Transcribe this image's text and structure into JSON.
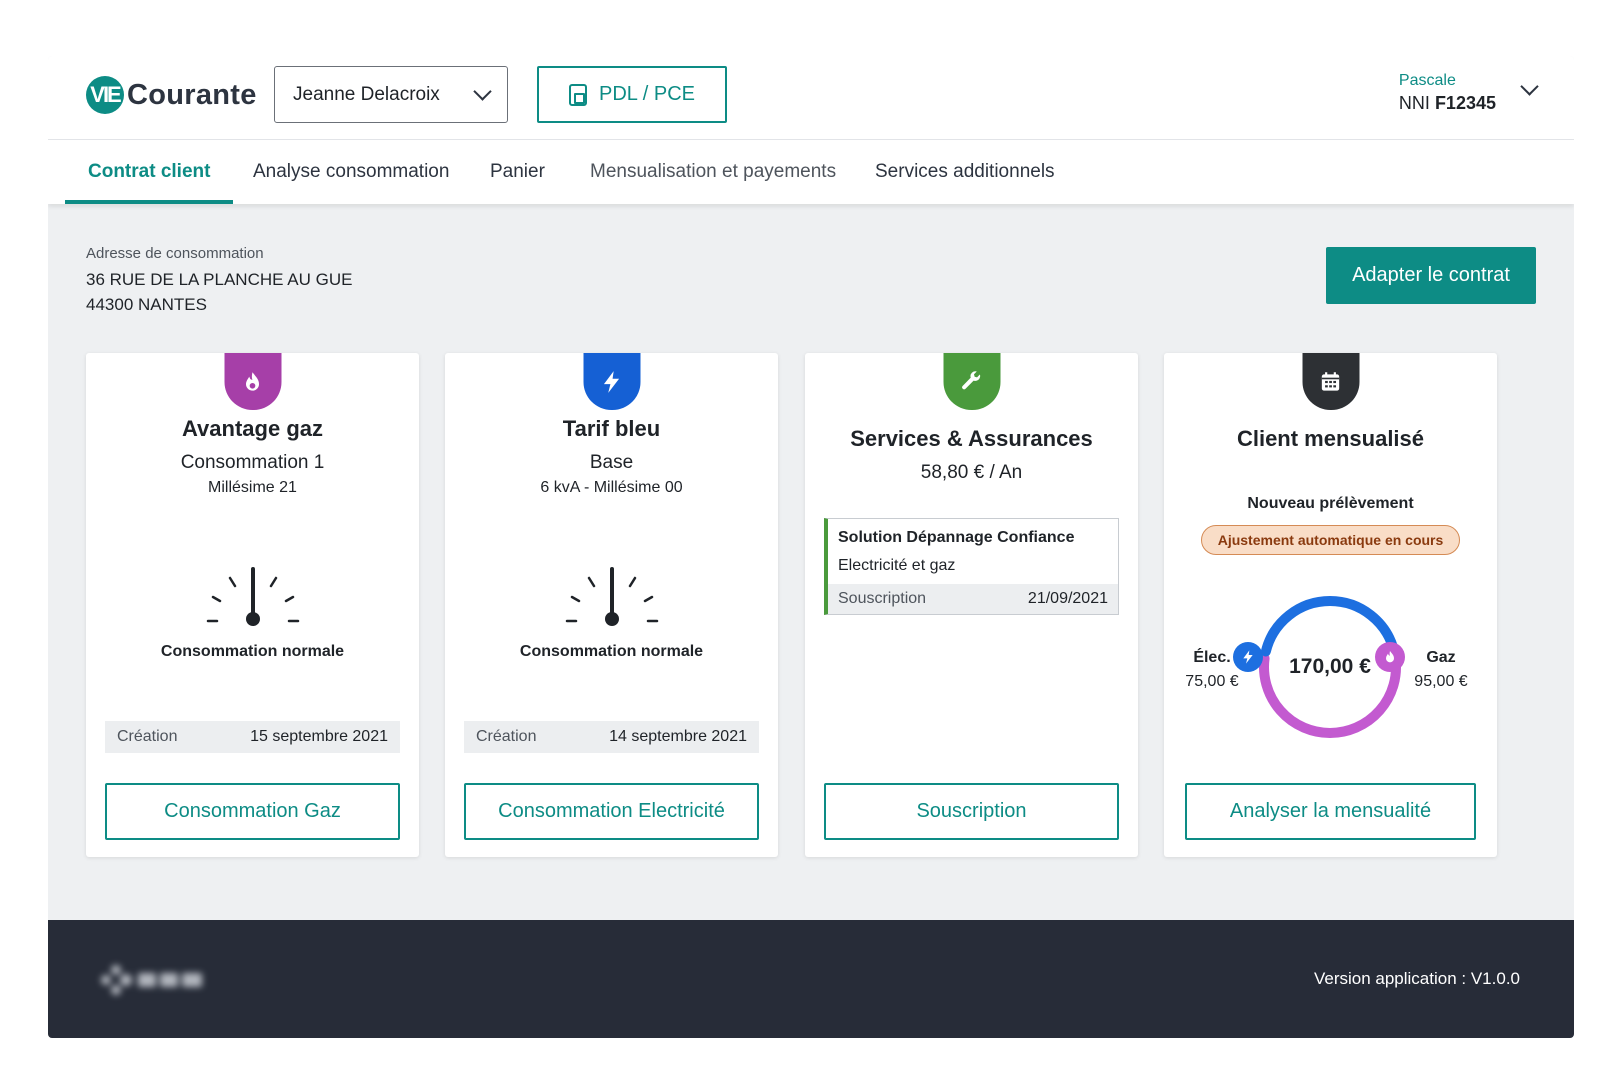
{
  "brand": {
    "mark": "VIE",
    "name": "Courante",
    "color": "#0d8c85"
  },
  "header": {
    "client_select": {
      "value": "Jeanne Delacroix"
    },
    "pdl_button": {
      "label": "PDL / PCE",
      "icon": "meter-icon"
    },
    "user": {
      "name": "Pascale",
      "nni_prefix": "NNI",
      "nni_value": "F12345"
    }
  },
  "tabs": [
    {
      "label": "Contrat client",
      "active": true
    },
    {
      "label": "Analyse consommation",
      "active": false
    },
    {
      "label": "Panier",
      "active": false
    },
    {
      "label": "Mensualisation et payements",
      "active": false
    },
    {
      "label": "Services additionnels",
      "active": false
    }
  ],
  "address": {
    "label": "Adresse de consommation",
    "line1": "36 RUE DE LA PLANCHE AU GUE",
    "line2": "44300 NANTES"
  },
  "adapt_button": {
    "label": "Adapter le contrat"
  },
  "cards": {
    "gas": {
      "icon": "flame-icon",
      "color": "#a63fa8",
      "title": "Avantage gaz",
      "sub1": "Consommation 1",
      "sub2": "Millésime 21",
      "gauge_label": "Consommation normale",
      "info_key": "Création",
      "info_value": "15 septembre 2021",
      "button": "Consommation Gaz"
    },
    "elec": {
      "icon": "lightning-icon",
      "color": "#1560d4",
      "title": "Tarif bleu",
      "sub1": "Base",
      "sub2": "6 kvA - Millésime 00",
      "gauge_label": "Consommation normale",
      "info_key": "Création",
      "info_value": "14 septembre 2021",
      "button": "Consommation Electricité"
    },
    "services": {
      "icon": "wrench-icon",
      "color": "#4a9a3c",
      "title": "Services & Assurances",
      "price": "58,80 € / An",
      "box_title": "Solution Dépannage Confiance",
      "box_desc": "Electricité et gaz",
      "box_key": "Souscription",
      "box_value": "21/09/2021",
      "button": "Souscription"
    },
    "monthly": {
      "icon": "calendar-icon",
      "color": "#2d3034",
      "title": "Client mensualisé",
      "label": "Nouveau prélèvement",
      "pill": "Ajustement automatique en cours",
      "total": "170,00 €",
      "elec_label": "Élec.",
      "elec_value": "75,00 €",
      "elec_amount": 75,
      "gas_label": "Gaz",
      "gas_value": "95,00 €",
      "gas_amount": 95,
      "elec_color": "#1d6fe0",
      "gas_color": "#c35ad0",
      "button": "Analyser la mensualité"
    }
  },
  "footer": {
    "version": "Version application : V1.0.0"
  }
}
